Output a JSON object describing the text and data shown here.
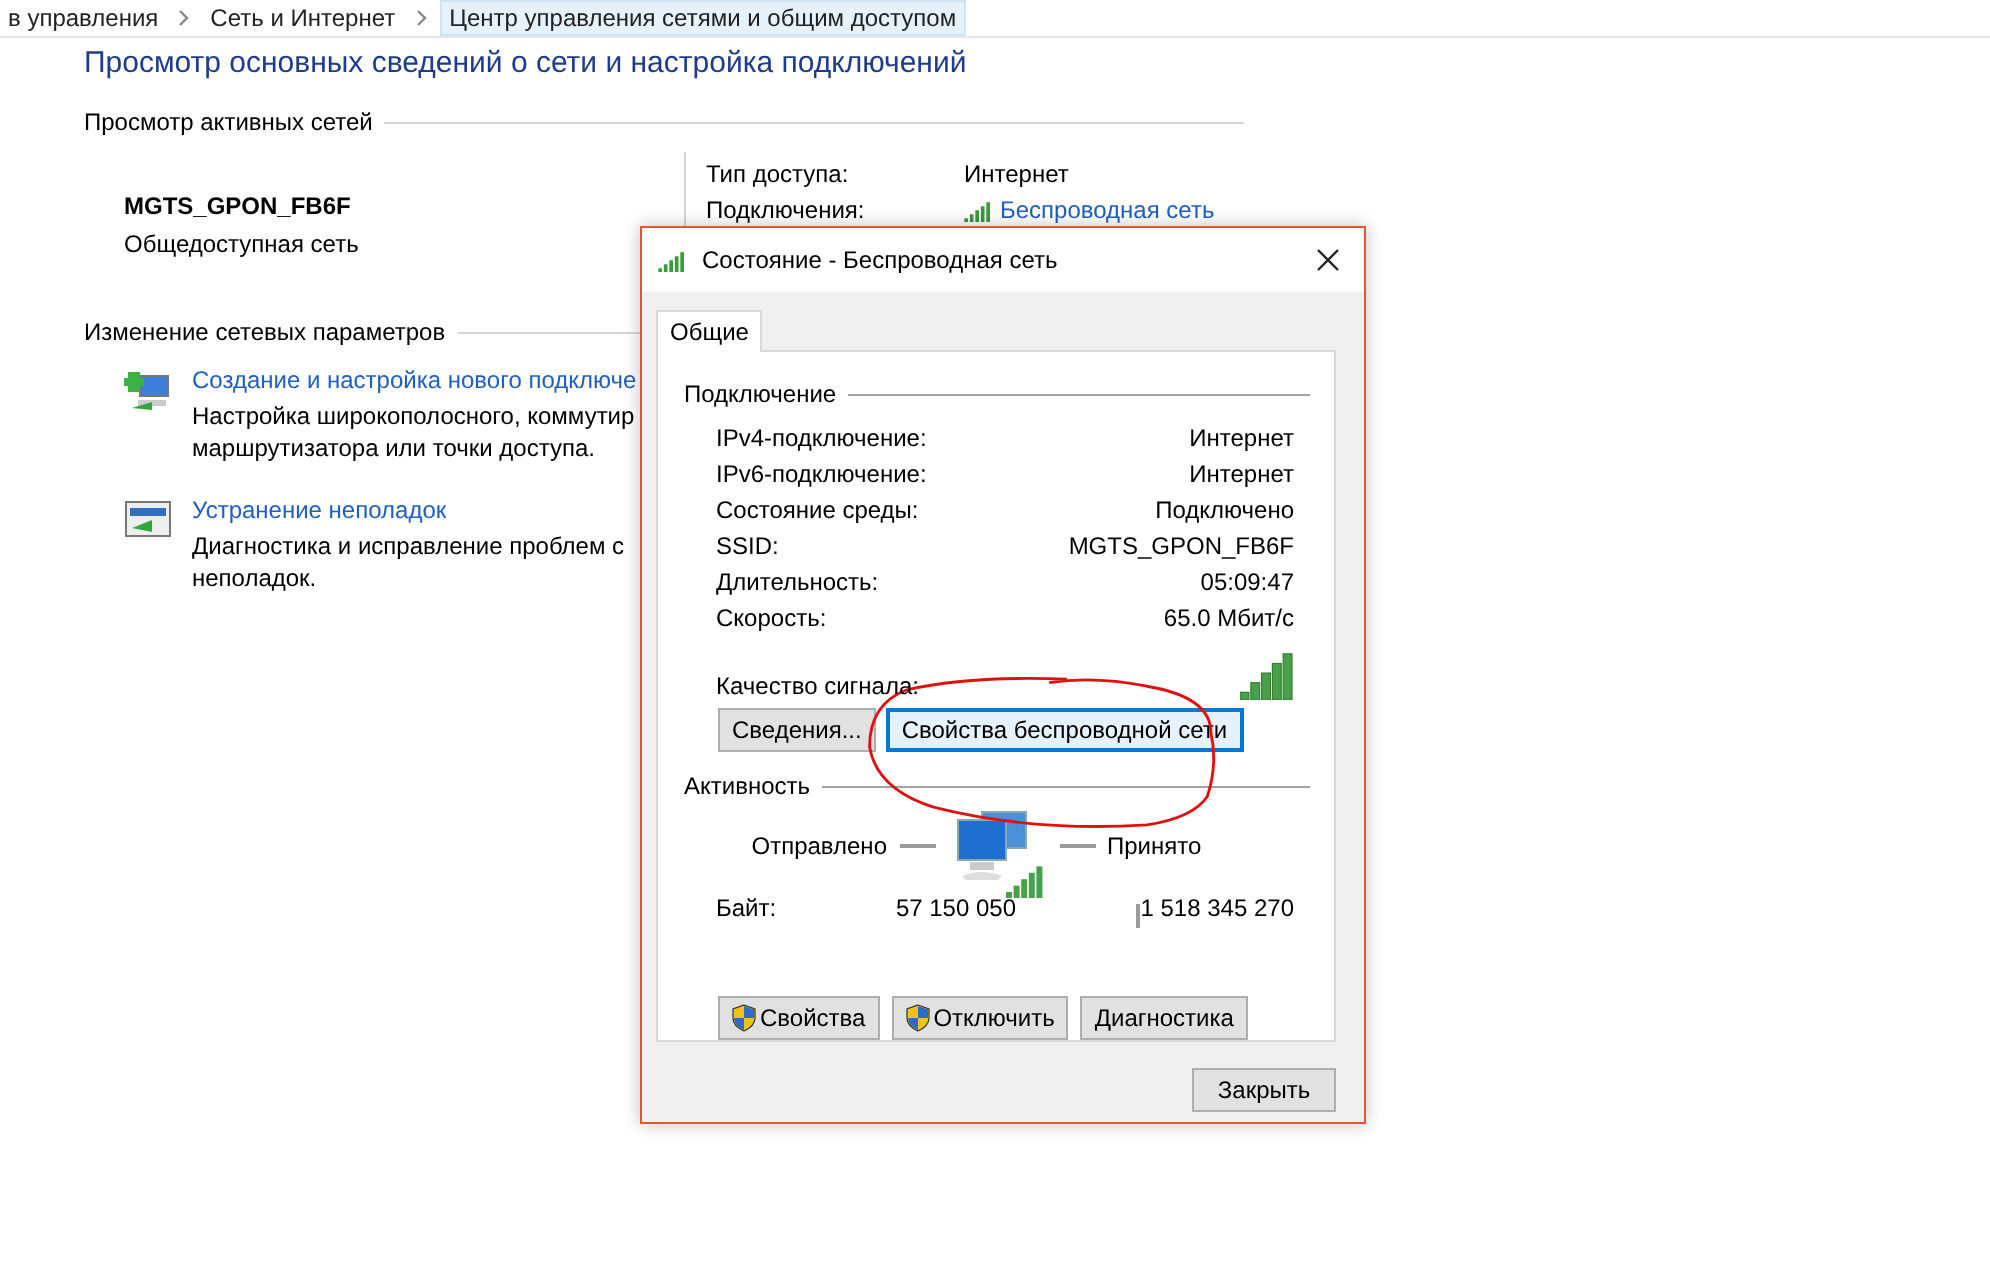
{
  "breadcrumb": [
    {
      "label": "в управления",
      "selected": false
    },
    {
      "label": "Сеть и Интернет",
      "selected": false
    },
    {
      "label": "Центр управления сетями и общим доступом",
      "selected": true
    }
  ],
  "page": {
    "title": "Просмотр основных сведений о сети и настройка подключений",
    "active_networks": {
      "heading": "Просмотр активных сетей",
      "network_name": "MGTS_GPON_FB6F",
      "network_type": "Общедоступная сеть",
      "details": [
        {
          "label": "Тип доступа:",
          "value": "Интернет",
          "kind": "text"
        },
        {
          "label": "Подключения:",
          "value": "Беспроводная сеть",
          "kind": "link"
        }
      ]
    },
    "settings": {
      "heading": "Изменение сетевых параметров",
      "items": [
        {
          "kind": "new-connection",
          "link": "Создание и настройка нового подключе",
          "description": [
            "Настройка широкополосного, коммутир",
            "маршрутизатора или точки доступа."
          ]
        },
        {
          "kind": "troubleshoot",
          "link": "Устранение неполадок",
          "description": [
            "Диагностика и исправление проблем с",
            "неполадок."
          ]
        }
      ]
    }
  },
  "dialog": {
    "title": "Состояние - Беспроводная сеть",
    "tabs": [
      {
        "label": "Общие",
        "selected": true
      }
    ],
    "connection": {
      "heading": "Подключение",
      "rows": [
        {
          "label": "IPv4-подключение:",
          "value": "Интернет"
        },
        {
          "label": "IPv6-подключение:",
          "value": "Интернет"
        },
        {
          "label": "Состояние среды:",
          "value": "Подключено"
        },
        {
          "label": "SSID:",
          "value": "MGTS_GPON_FB6F"
        },
        {
          "label": "Длительность:",
          "value": "05:09:47"
        },
        {
          "label": "Скорость:",
          "value": "65.0 Мбит/с"
        }
      ],
      "signal_label": "Качество сигнала:",
      "buttons": [
        {
          "label": "Сведения...",
          "focused": false
        },
        {
          "label": "Свойства беспроводной сети",
          "focused": true
        }
      ]
    },
    "activity": {
      "heading": "Активность",
      "sent_label": "Отправлено",
      "received_label": "Принято",
      "bytes_label": "Байт:",
      "bytes_sent": "57 150 050",
      "bytes_received": "1 518 345 270",
      "buttons": [
        {
          "label": "Свойства",
          "shield": true
        },
        {
          "label": "Отключить",
          "shield": true
        },
        {
          "label": "Диагностика",
          "shield": false
        }
      ]
    },
    "close_button": "Закрыть"
  }
}
